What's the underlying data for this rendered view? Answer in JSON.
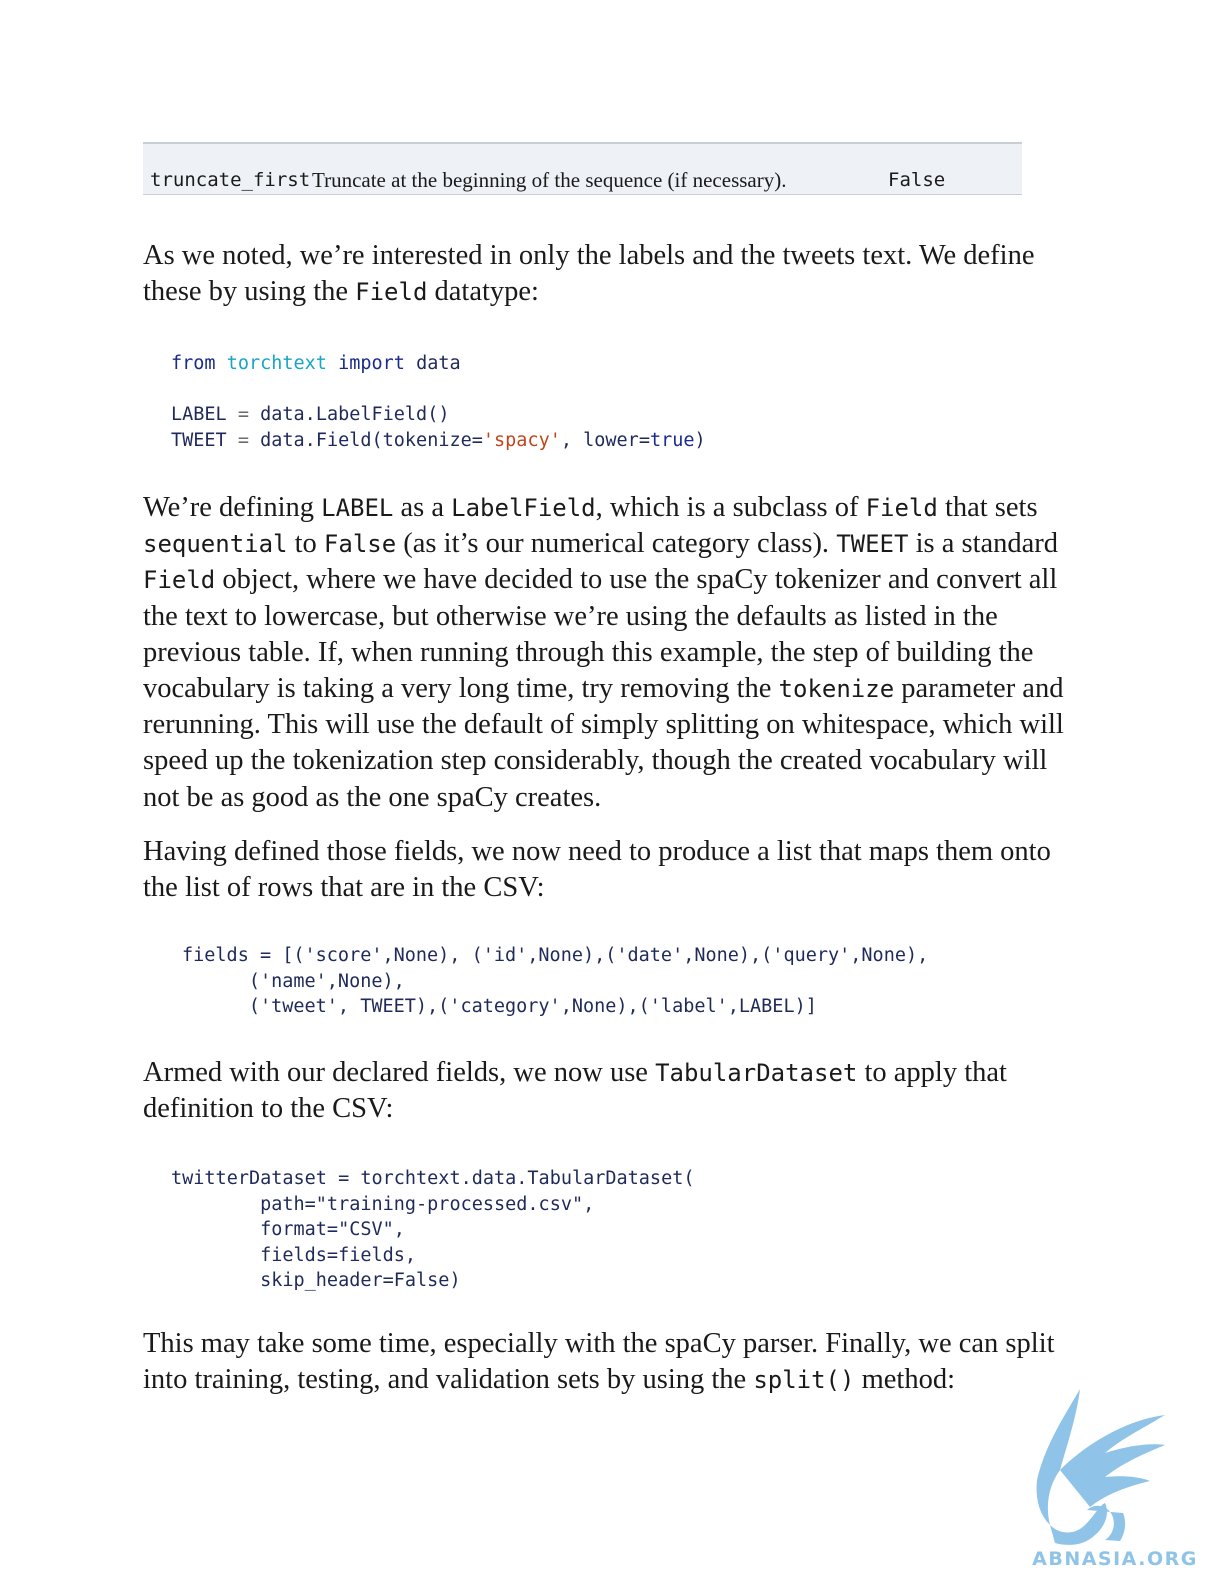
{
  "table_row": {
    "name": "truncate_first",
    "description": "Truncate at the beginning of the sequence (if necessary).",
    "default": "False"
  },
  "p1": {
    "t1": "As we noted, we’re interested in only the labels and the tweets text. We define these by using the ",
    "c1": "Field",
    "t2": " datatype:"
  },
  "code1": {
    "l1_from": "from",
    "l1_mod": "torchtext",
    "l1_import": "import",
    "l1_name": "data",
    "l2_var": "LABEL",
    "l2_eq": "=",
    "l2_call": "data.LabelField()",
    "l3_var": "TWEET",
    "l3_eq": "=",
    "l3_call1": "data.Field(tokenize=",
    "l3_str": "'spacy'",
    "l3_sep": ", lower=",
    "l3_true": "true",
    "l3_end": ")"
  },
  "p2": {
    "t1": "We’re defining ",
    "c1": "LABEL",
    "t2": " as a ",
    "c2": "LabelField",
    "t3": ", which is a subclass of ",
    "c3": "Field",
    "t4": " that sets ",
    "c4": "sequential",
    "t5": " to ",
    "c5": "False",
    "t6": " (as it’s our numerical category class). ",
    "c6": "TWEET",
    "t7": " is a standard ",
    "c7": "Field",
    "t8": " object, where we have decided to use the spaCy tokenizer and convert all the text to lowercase, but otherwise we’re using the defaults as listed in the previous table. If, when running through this example, the step of building the vocabulary is taking a very long time, try removing the ",
    "c8": "tokenize",
    "t9": " parameter and rerunning. This will use the default of simply splitting on whitespace, which will speed up the tokenization step considerably, though the created vocabulary will not be as good as the one spaCy creates."
  },
  "p3": {
    "t1": "Having defined those fields, we now need to produce a list that maps them onto the list of rows that are in the CSV:"
  },
  "code2": {
    "line1": "fields = [('score',None), ('id',None),('date',None),('query',None),",
    "line2": "      ('name',None),",
    "line3": "      ('tweet', TWEET),('category',None),('label',LABEL)]"
  },
  "p4": {
    "t1": "Armed with our declared fields, we now use ",
    "c1": "TabularDataset",
    "t2": " to apply that definition to the CSV:"
  },
  "code3": {
    "line1": "twitterDataset = torchtext.data.TabularDataset(",
    "line2": "        path=\"training-processed.csv\",",
    "line3": "        format=\"CSV\",",
    "line4": "        fields=fields,",
    "line5": "        skip_header=False)"
  },
  "p5": {
    "t1": "This may take some time, especially with the spaCy parser. Finally, we can split into training, testing, and validation sets by using the ",
    "c1": "split()",
    "t2": " method:"
  },
  "watermark": {
    "text": "ABNASIA.ORG",
    "color": "#8fc3e8"
  }
}
